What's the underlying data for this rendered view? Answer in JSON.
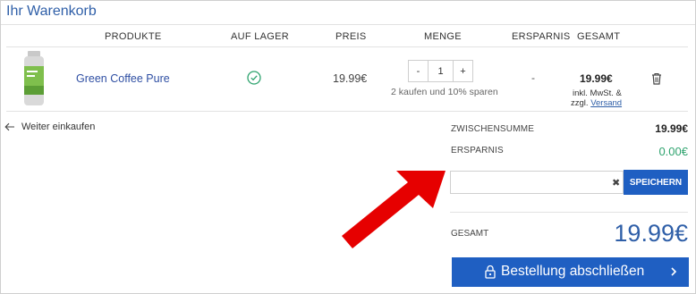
{
  "page": {
    "title": "Ihr Warenkorb"
  },
  "table": {
    "headers": {
      "products": "PRODUKTE",
      "in_stock": "AUF LAGER",
      "price": "PREIS",
      "quantity": "MENGE",
      "savings": "ERSPARNIS",
      "total": "GESAMT"
    },
    "item": {
      "name": "Green Coffee Pure",
      "price": "19.99€",
      "quantity": "1",
      "decrement": "-",
      "increment": "+",
      "promo": "2 kaufen und 10% sparen",
      "savings": "-",
      "total": "19.99€",
      "tax_line1": "inkl. MwSt. &",
      "tax_line2_prefix": "zzgl. ",
      "shipping_link": "Versand"
    }
  },
  "continue_shopping": "Weiter einkaufen",
  "summary": {
    "subtotal_label": "ZWISCHENSUMME",
    "subtotal_value": "19.99€",
    "savings_label": "ERSPARNIS",
    "savings_value": "0.00€",
    "coupon_value": "",
    "clear_symbol": "✖",
    "save_button": "SPEICHERN",
    "total_label": "GESAMT",
    "total_value": "19.99€"
  },
  "checkout_button": "Bestellung abschließen",
  "colors": {
    "accent_blue": "#1f5fc2",
    "title_blue": "#2f5fa8",
    "savings_green": "#2ea36e",
    "stock_green": "#2ea36e",
    "annotation_arrow": "#e60000"
  },
  "icons": {
    "stock": "check-circle-icon",
    "remove": "trash-icon",
    "back": "arrow-left-icon",
    "checkout_lock": "lock-icon",
    "checkout_chevron": "chevron-right-icon"
  }
}
